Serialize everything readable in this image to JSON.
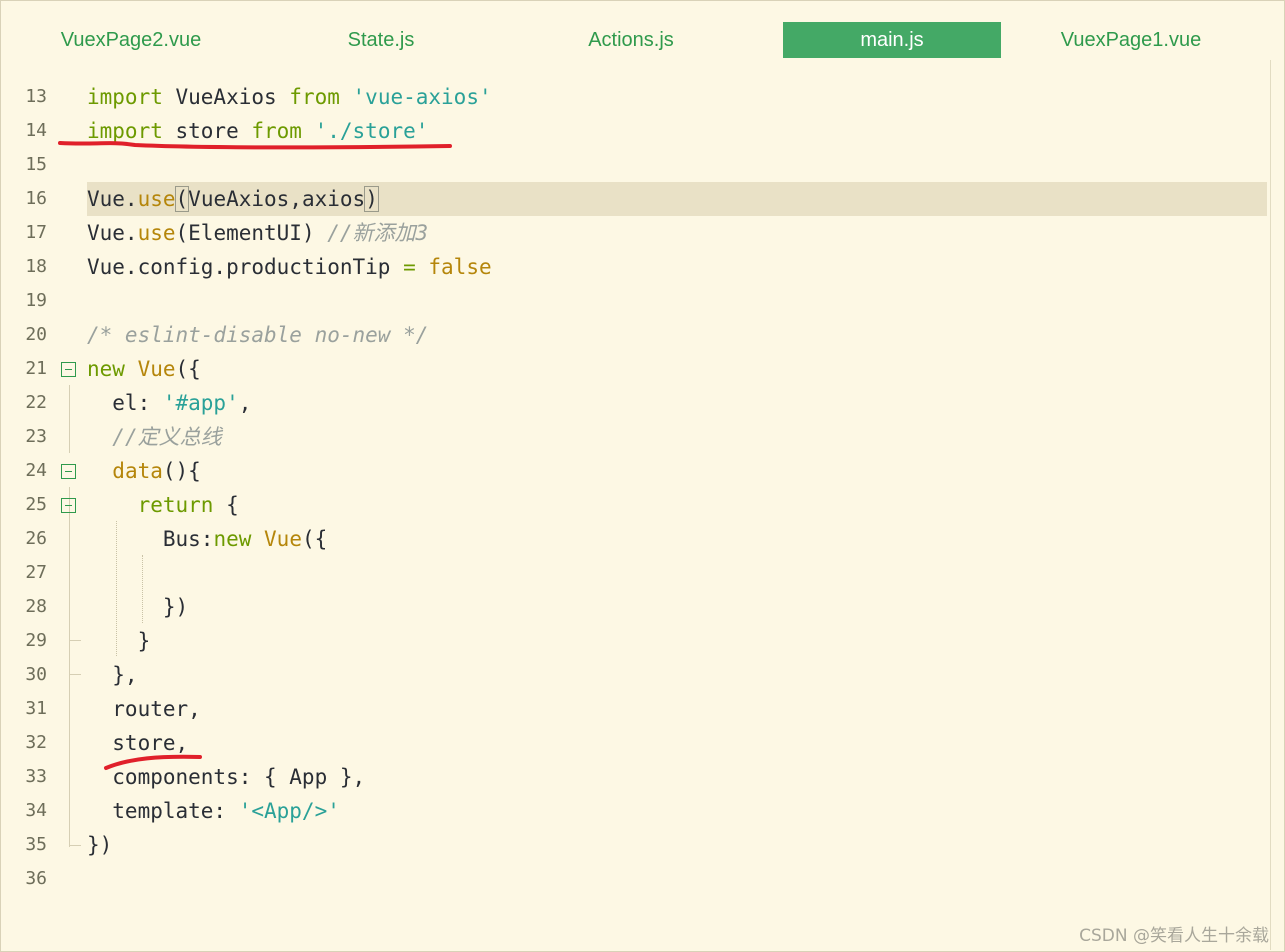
{
  "tabs": [
    {
      "label": "VuexPage2.vue",
      "active": false
    },
    {
      "label": "State.js",
      "active": false
    },
    {
      "label": "Actions.js",
      "active": false
    },
    {
      "label": "main.js",
      "active": true
    },
    {
      "label": "VuexPage1.vue",
      "active": false
    }
  ],
  "editor": {
    "lines": [
      {
        "n": "13",
        "tokens": [
          {
            "t": "import",
            "c": "kw"
          },
          {
            "t": " VueAxios "
          },
          {
            "t": "from",
            "c": "kw"
          },
          {
            "t": " "
          },
          {
            "t": "'vue-axios'",
            "c": "str"
          }
        ]
      },
      {
        "n": "14",
        "tokens": [
          {
            "t": "import",
            "c": "kw"
          },
          {
            "t": " store "
          },
          {
            "t": "from",
            "c": "kw"
          },
          {
            "t": " "
          },
          {
            "t": "'./store'",
            "c": "str"
          }
        ]
      },
      {
        "n": "15",
        "tokens": []
      },
      {
        "n": "16",
        "highlight": true,
        "tokens": [
          {
            "t": "Vue."
          },
          {
            "t": "use",
            "c": "fn"
          },
          {
            "t": "(",
            "c": "brk"
          },
          {
            "t": "VueAxios,axios"
          },
          {
            "t": ")",
            "c": "brk"
          }
        ]
      },
      {
        "n": "17",
        "tokens": [
          {
            "t": "Vue."
          },
          {
            "t": "use",
            "c": "fn"
          },
          {
            "t": "(ElementUI) "
          },
          {
            "t": "//新添加3",
            "c": "cm"
          }
        ]
      },
      {
        "n": "18",
        "tokens": [
          {
            "t": "Vue.config.productionTip "
          },
          {
            "t": "=",
            "c": "kw"
          },
          {
            "t": " "
          },
          {
            "t": "false",
            "c": "fn"
          }
        ]
      },
      {
        "n": "19",
        "tokens": []
      },
      {
        "n": "20",
        "tokens": [
          {
            "t": "/* eslint-disable no-new */",
            "c": "cm"
          }
        ]
      },
      {
        "n": "21",
        "fold": true,
        "tokens": [
          {
            "t": "new",
            "c": "kw"
          },
          {
            "t": " "
          },
          {
            "t": "Vue",
            "c": "fn"
          },
          {
            "t": "({"
          }
        ]
      },
      {
        "n": "22",
        "tokens": [
          {
            "t": "  el: "
          },
          {
            "t": "'#app'",
            "c": "str"
          },
          {
            "t": ","
          }
        ]
      },
      {
        "n": "23",
        "tokens": [
          {
            "t": "  "
          },
          {
            "t": "//定义总线",
            "c": "cm"
          }
        ]
      },
      {
        "n": "24",
        "fold": true,
        "tokens": [
          {
            "t": "  "
          },
          {
            "t": "data",
            "c": "fn"
          },
          {
            "t": "(){"
          }
        ]
      },
      {
        "n": "25",
        "fold": true,
        "tokens": [
          {
            "t": "    "
          },
          {
            "t": "return",
            "c": "kw"
          },
          {
            "t": " {"
          }
        ]
      },
      {
        "n": "26",
        "tokens": [
          {
            "t": "      Bus:"
          },
          {
            "t": "new",
            "c": "kw"
          },
          {
            "t": " "
          },
          {
            "t": "Vue",
            "c": "fn"
          },
          {
            "t": "({"
          }
        ]
      },
      {
        "n": "27",
        "tokens": []
      },
      {
        "n": "28",
        "tokens": [
          {
            "t": "      })"
          }
        ]
      },
      {
        "n": "29",
        "tokens": [
          {
            "t": "    }"
          }
        ]
      },
      {
        "n": "30",
        "tokens": [
          {
            "t": "  },"
          }
        ]
      },
      {
        "n": "31",
        "tokens": [
          {
            "t": "  router,"
          }
        ]
      },
      {
        "n": "32",
        "tokens": [
          {
            "t": "  store,"
          }
        ]
      },
      {
        "n": "33",
        "tokens": [
          {
            "t": "  components: { App },"
          }
        ]
      },
      {
        "n": "34",
        "tokens": [
          {
            "t": "  template: "
          },
          {
            "t": "'<App/>'",
            "c": "str"
          }
        ]
      },
      {
        "n": "35",
        "tokens": [
          {
            "t": "})"
          }
        ]
      },
      {
        "n": "36",
        "tokens": []
      }
    ]
  },
  "watermark": "CSDN @笑看人生十余载",
  "colors": {
    "background": "#fdf8e4",
    "tab_active": "#44a966",
    "tab_text": "#2f9a4c",
    "keyword": "#6d9a00",
    "function": "#b5860b",
    "string": "#2aa198",
    "comment": "#9aa19d",
    "annotation": "#e0202a"
  }
}
